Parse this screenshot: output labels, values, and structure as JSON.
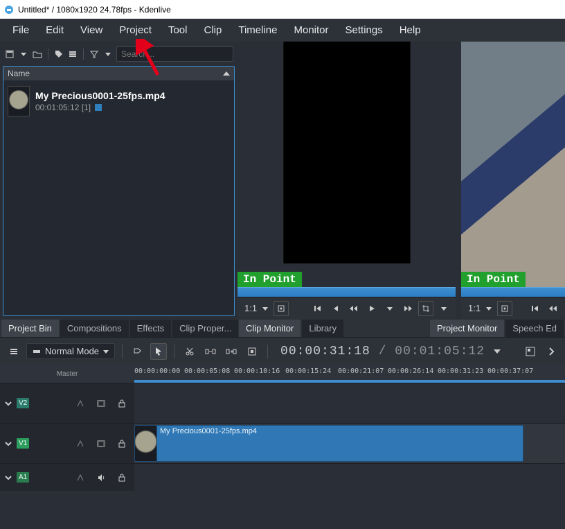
{
  "title": "Untitled* / 1080x1920 24.78fps - Kdenlive",
  "menu": [
    "File",
    "Edit",
    "View",
    "Project",
    "Tool",
    "Clip",
    "Timeline",
    "Monitor",
    "Settings",
    "Help"
  ],
  "search_placeholder": "Search...",
  "bin_header": "Name",
  "clip": {
    "name": "My Precious0001-25fps.mp4",
    "meta": "00:01:05:12 [1]"
  },
  "in_point_label": "In Point",
  "zoom_label": "1:1",
  "left_tabs": {
    "items": [
      "Project Bin",
      "Compositions",
      "Effects",
      "Clip Proper..."
    ],
    "active": 0
  },
  "mid_tabs": {
    "items": [
      "Clip Monitor",
      "Library"
    ],
    "active": 0
  },
  "right_tabs": {
    "items": [
      "Project Monitor",
      "Speech Ed"
    ],
    "active": 0
  },
  "mode_label": "Normal Mode",
  "timecode": "00:00:31:18",
  "duration": "00:01:05:12",
  "master_label": "Master",
  "ruler_ticks": [
    "00:00:00:00",
    "00:00:05:08",
    "00:00:10:16",
    "00:00:15:24",
    "00:00:21:07",
    "00:00:26:14",
    "00:00:31:23",
    "00:00:37:07"
  ],
  "tracks": {
    "v2": "V2",
    "v1": "V1",
    "a1": "A1"
  },
  "timeline_clip_name": "My Precious0001-25fps.mp4"
}
